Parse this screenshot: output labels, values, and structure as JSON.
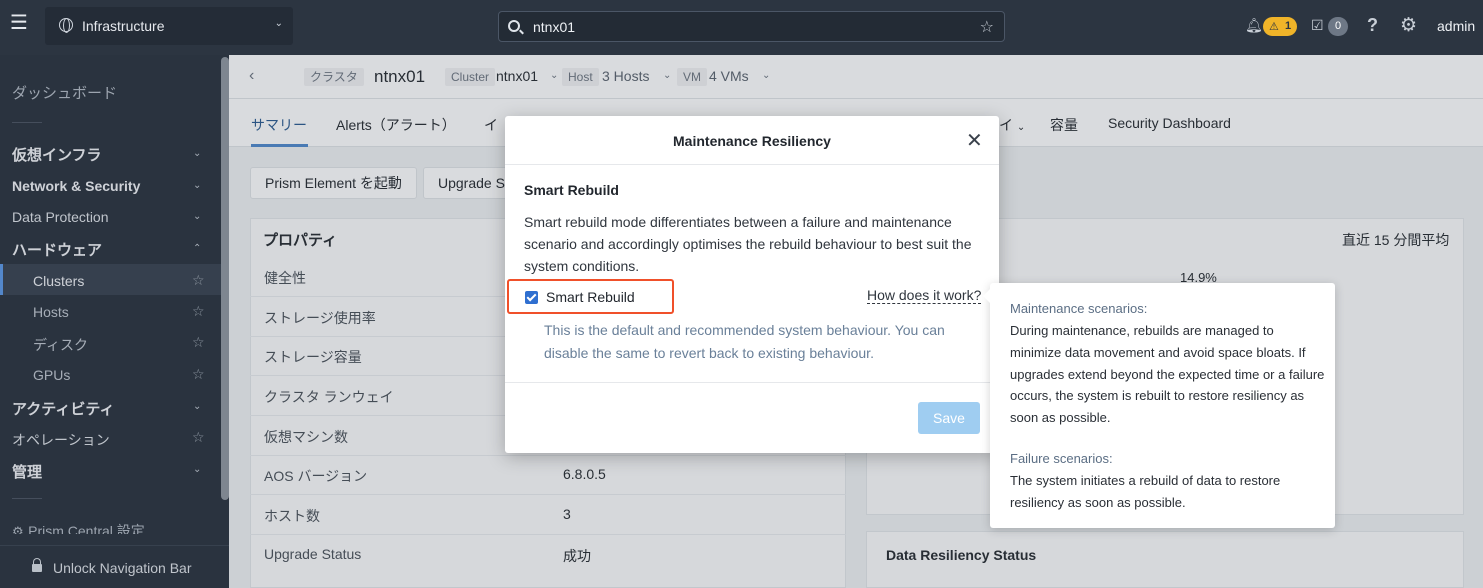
{
  "topbar": {
    "app_name": "Infrastructure",
    "search_value": "ntnx01",
    "alerts_count": "1",
    "tasks_count": "0",
    "user": "admin"
  },
  "sidebar": {
    "dashboard": "ダッシュボード",
    "virtual_infra": "仮想インフラ",
    "network_security": "Network & Security",
    "data_protection": "Data Protection",
    "hardware": "ハードウェア",
    "clusters": "Clusters",
    "hosts": "Hosts",
    "disks": "ディスク",
    "gpus": "GPUs",
    "activity": "アクティビティ",
    "operations": "オペレーション",
    "admin": "管理",
    "prism_central_settings": "Prism Central 設定",
    "unlock_nav": "Unlock Navigation Bar"
  },
  "breadcrumb": {
    "cluster_tag": "クラスタ",
    "cluster_name": "ntnx01",
    "cluster_label": "Cluster",
    "cluster_value": "ntnx01",
    "host_label": "Host",
    "host_value": "3 Hosts",
    "vm_label": "VM",
    "vm_value": "4 VMs"
  },
  "tabs": {
    "summary": "サマリー",
    "alerts": "Alerts（アラート）",
    "events_partial": "イ",
    "more_partial": "イ",
    "capacity": "容量",
    "security_dashboard": "Security Dashboard"
  },
  "actions": {
    "launch_pe": "Prism Element を起動",
    "upgrade": "Upgrade Se"
  },
  "properties": {
    "title": "プロパティ",
    "rows": [
      {
        "key": "健全性",
        "value": ""
      },
      {
        "key": "ストレージ使用率",
        "value": ""
      },
      {
        "key": "ストレージ容量",
        "value": ""
      },
      {
        "key": "クラスタ ランウェイ",
        "value": ""
      },
      {
        "key": "仮想マシン数",
        "value": ""
      },
      {
        "key": "AOS バージョン",
        "value": "6.8.0.5"
      },
      {
        "key": "ホスト数",
        "value": "3"
      },
      {
        "key": "Upgrade Status",
        "value": "成功"
      }
    ]
  },
  "right_panel": {
    "avg_label": "直近 15 分間平均",
    "cpu_pct": "14.9%",
    "data_resiliency_title": "Data Resiliency Status"
  },
  "modal": {
    "title": "Maintenance Resiliency",
    "section_title": "Smart Rebuild",
    "description": "Smart rebuild mode differentiates between a failure and maintenance scenario and accordingly optimises the rebuild behaviour to best suit the system conditions.",
    "checkbox_label": "Smart Rebuild",
    "checkbox_checked": true,
    "how_link": "How does it work?",
    "note": "This is the default and recommended system behaviour. You can disable the same to revert back to existing behaviour.",
    "save_label": "Save"
  },
  "tooltip": {
    "maintenance_heading": "Maintenance scenarios:",
    "maintenance_text": "During maintenance, rebuilds are managed to minimize data movement and avoid space bloats. If upgrades extend beyond the expected time or a failure occurs, the system is rebuilt to restore resiliency as soon as possible.",
    "failure_heading": "Failure scenarios:",
    "failure_text": "The system initiates a rebuild of data to restore resiliency as soon as possible."
  },
  "colors": {
    "topbar": "#2c3541",
    "accent": "#2f6fd0",
    "highlight_box": "#f0502a",
    "save_disabled": "#9fcdf1"
  }
}
